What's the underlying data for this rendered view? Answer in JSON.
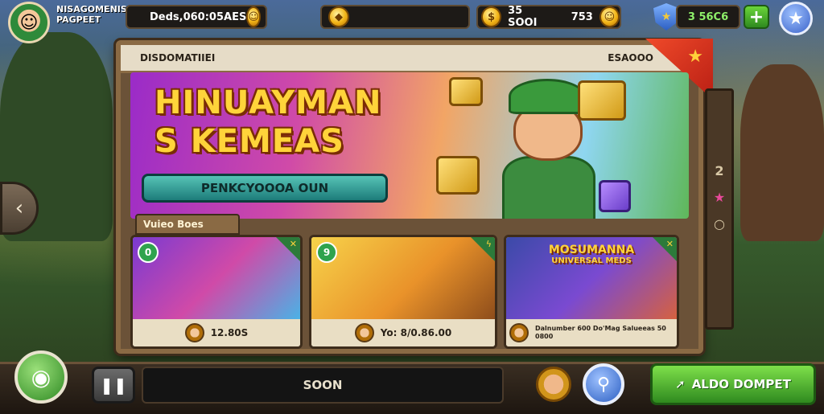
{
  "player": {
    "name": "NISAGOMENIS PAGPEET"
  },
  "currencies": [
    {
      "icon": "smiley-coin-icon",
      "value": "Deds,060:05AES"
    },
    {
      "icon": "gold-gem-icon",
      "value": ""
    },
    {
      "icon": "gold-coin-icon",
      "value": "35 SOOI"
    },
    {
      "icon": "smiley-coin-icon",
      "value": "753"
    },
    {
      "icon": "shield-icon",
      "value": "3 56C6"
    }
  ],
  "panel": {
    "title": "DISDOMATIIEI",
    "right_label": "ESAOOO",
    "banner": {
      "title_line1": "HINUAYMAN",
      "title_line2": "S KEMEAS",
      "cta": "PENKCYOOOA OUN"
    },
    "section_tab": "Vuieo Boes",
    "cards": [
      {
        "badge": "0",
        "price": "12.80S"
      },
      {
        "badge": "9",
        "price": "Yo: 8/0.86.00"
      },
      {
        "title": "MOSUMANNA",
        "subtitle": "UNIVERSAL MEDS",
        "price": "Dalnumber 600 Do'Mag Salueeas 50 0800"
      }
    ],
    "rail_items": [
      "2",
      "★",
      "○"
    ]
  },
  "bottom": {
    "status": "SOON",
    "main_button": "ALDO DOMPET"
  },
  "colors": {
    "accent_green": "#2f8a1f",
    "accent_blue": "#2c5fc2",
    "gold": "#f2b416",
    "wood": "#8a6a44"
  }
}
